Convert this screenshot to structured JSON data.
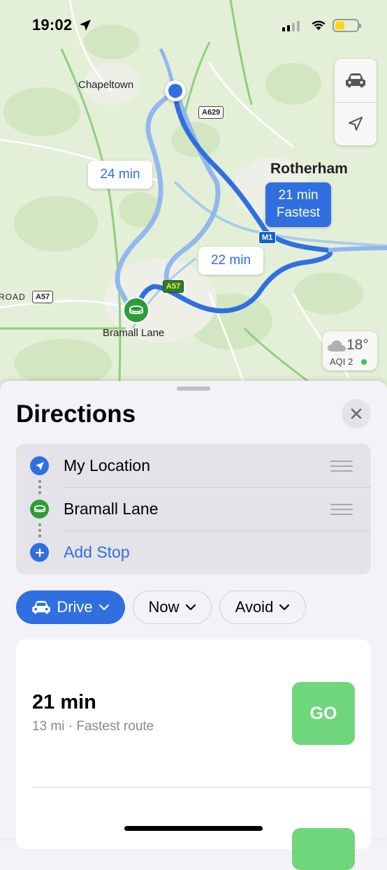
{
  "status_bar": {
    "time": "19:02"
  },
  "map": {
    "labels": {
      "chapeltown": "Chapeltown",
      "rotherham": "Rotherham",
      "bramall_lane": "Bramall Lane",
      "road": "ROAD"
    },
    "road_signs": {
      "a629": "A629",
      "a57_left": "A57",
      "a57": "A57",
      "m1": "M1"
    },
    "route_bubbles": {
      "alt1": "24 min",
      "alt2": "22 min",
      "fastest_time": "21 min",
      "fastest_label": "Fastest"
    },
    "weather": {
      "temp": "18°",
      "aqi": "AQI 2"
    }
  },
  "sheet": {
    "title": "Directions",
    "stops": [
      {
        "label": "My Location"
      },
      {
        "label": "Bramall Lane"
      },
      {
        "label": "Add Stop"
      }
    ],
    "options": {
      "drive": "Drive",
      "now": "Now",
      "avoid": "Avoid"
    },
    "routes": [
      {
        "time": "21 min",
        "detail": "13 mi · Fastest route",
        "go": "GO"
      }
    ]
  },
  "colors": {
    "accent": "#2f6fe0",
    "go": "#6fd67b",
    "map_bg": "#e4efd7",
    "route": "#2f6fe0"
  }
}
